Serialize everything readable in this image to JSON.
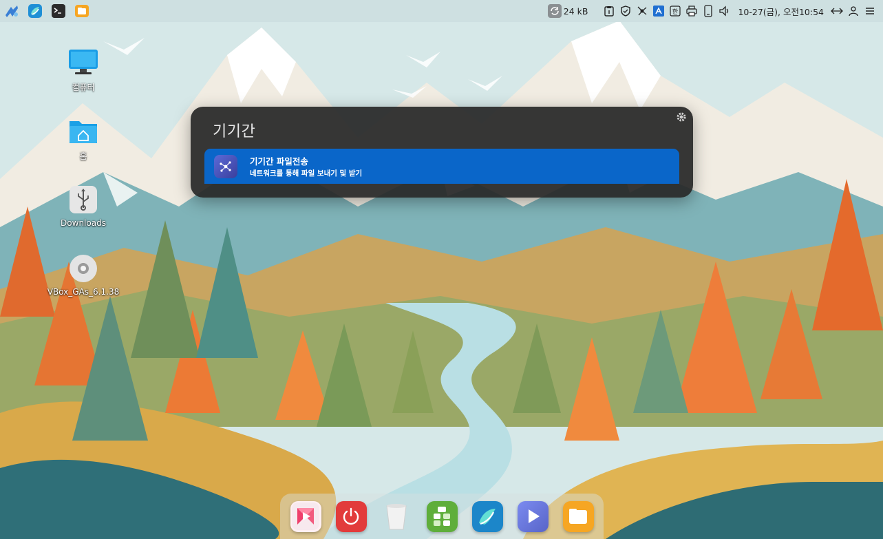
{
  "topbar": {
    "apps": [
      {
        "icon": "launcher-logo-icon"
      },
      {
        "icon": "browser-icon"
      },
      {
        "icon": "terminal-icon"
      },
      {
        "icon": "files-icon"
      }
    ],
    "net_speed": "24 kB",
    "tray_icons": [
      "clipboard-icon",
      "security-shield-icon",
      "device-connect-icon",
      "input-method-icon",
      "keyboard-layout-icon",
      "printer-icon",
      "phone-icon",
      "volume-icon"
    ],
    "clock": "10-27(금), 오전10:54"
  },
  "desktop": {
    "icons": [
      {
        "label": "컴퓨터",
        "icon": "computer-icon"
      },
      {
        "label": "홈",
        "icon": "home-folder-icon"
      },
      {
        "label": "Downloads",
        "icon": "usb-drive-icon"
      },
      {
        "label": "VBox_GAs_6.1.38",
        "icon": "cd-disc-icon"
      }
    ]
  },
  "launcher": {
    "query": "기기간",
    "results": [
      {
        "title": "기기간 파일전송",
        "subtitle": "네트워크를 통해 파일 보내기 및 받기",
        "icon": "file-transfer-icon"
      }
    ]
  },
  "dock": {
    "apps": [
      {
        "icon": "media-player-icon"
      },
      {
        "icon": "power-icon"
      },
      {
        "icon": "trash-icon"
      },
      {
        "icon": "software-center-icon"
      },
      {
        "icon": "browser-icon"
      },
      {
        "icon": "video-player-icon"
      },
      {
        "icon": "files-icon"
      }
    ]
  },
  "colors": {
    "accent": "#0a66c9",
    "launcher_bg": "#282828"
  }
}
